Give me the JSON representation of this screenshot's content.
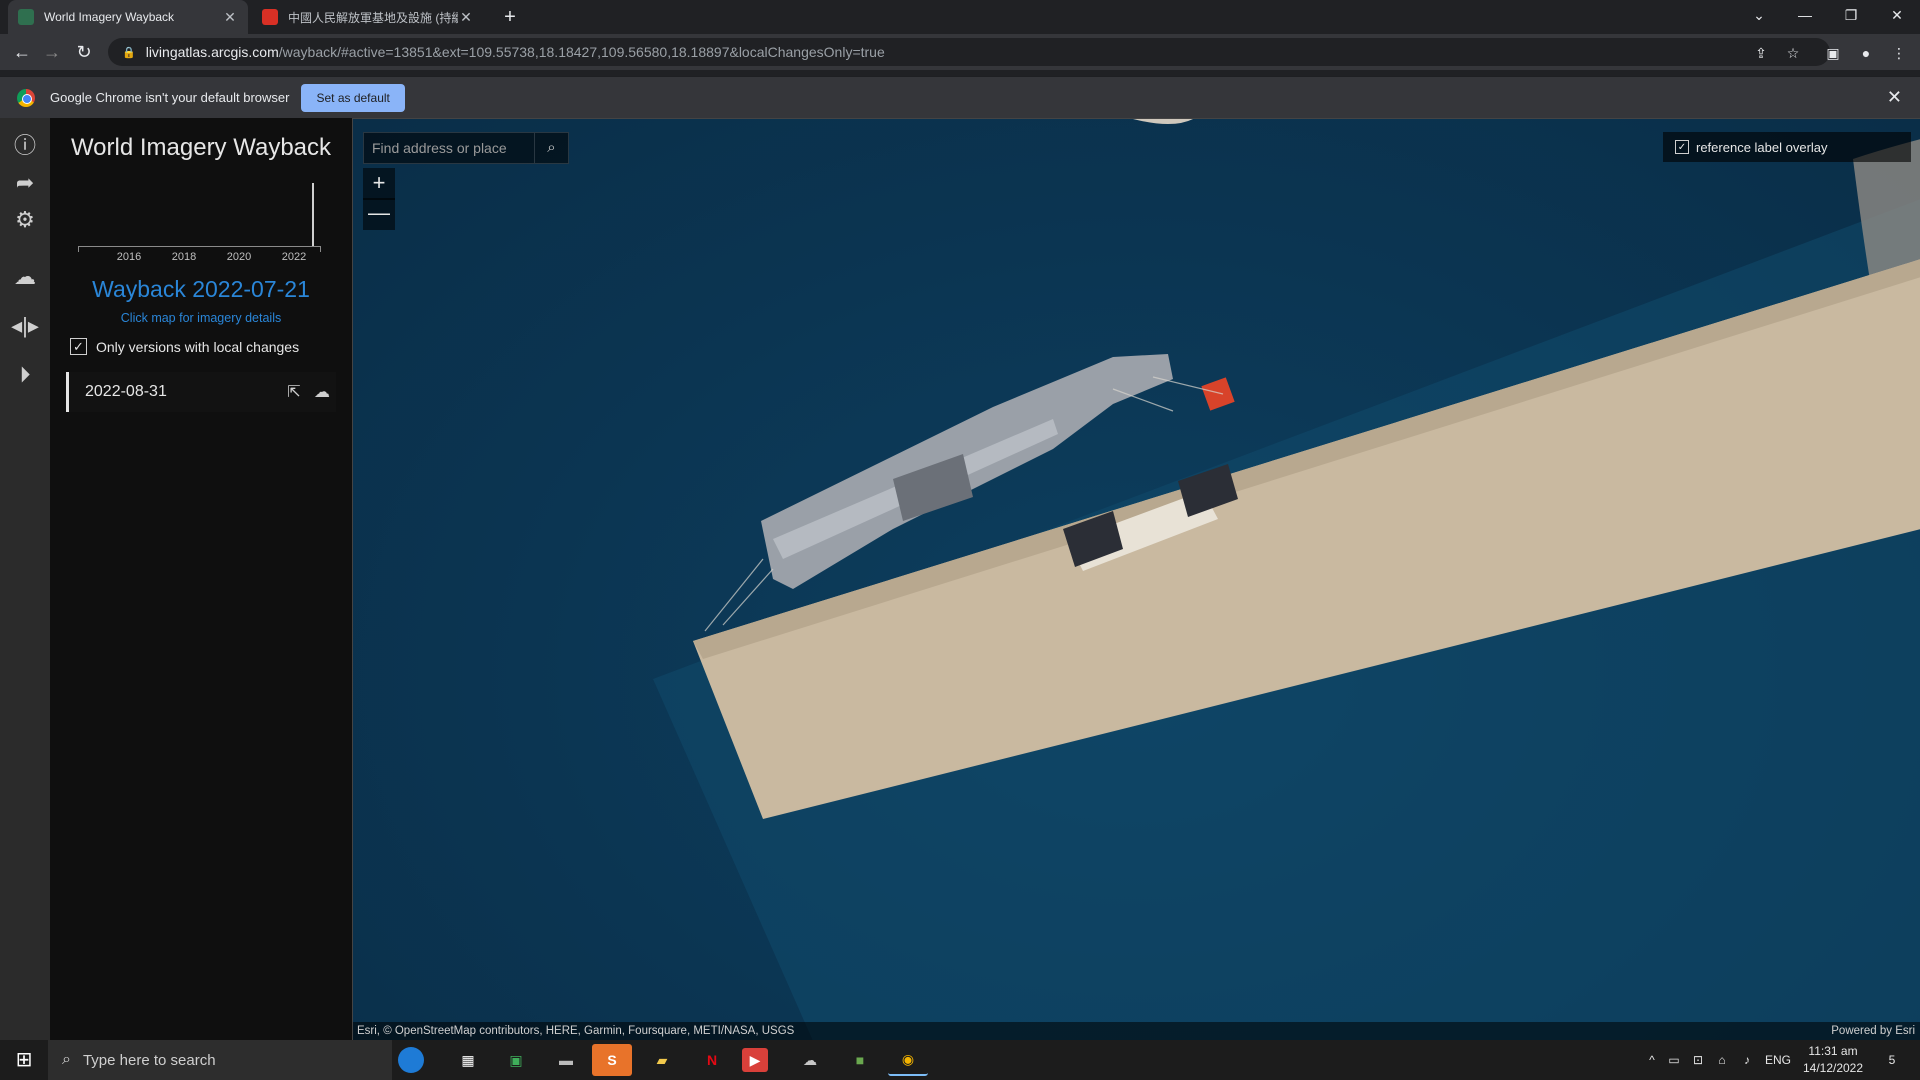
{
  "browser": {
    "tabs": [
      {
        "title": "World Imagery Wayback",
        "active": true,
        "favicon_color": "#2f6f4f"
      },
      {
        "title": "中國人民解放軍基地及設施 (持續",
        "active": false,
        "favicon_color": "#d93025"
      }
    ],
    "url_host": "livingatlas.arcgis.com",
    "url_path": "/wayback/#active=13851&ext=109.55738,18.18427,109.56580,18.18897&localChangesOnly=true",
    "infobar_message": "Google Chrome isn't your default browser",
    "infobar_button": "Set as default"
  },
  "app": {
    "title": "World Imagery Wayback",
    "timeline_years": [
      "2016",
      "2018",
      "2020",
      "2022"
    ],
    "release_label": "Wayback 2022-07-21",
    "hint": "Click map for imagery details",
    "local_changes_label": "Only versions with local changes",
    "local_changes_checked": true,
    "versions": [
      {
        "date": "2022-08-31"
      }
    ],
    "leftnav_icons": [
      "info-icon",
      "share-icon",
      "gear-icon",
      "swipe-cloud-icon",
      "swipe-icon",
      "play-icon"
    ]
  },
  "map": {
    "search_placeholder": "Find address or place",
    "zoom_in": "+",
    "zoom_out": "—",
    "overlay_label": "reference label overlay",
    "overlay_checked": true,
    "attribution": "Esri, © OpenStreetMap contributors, HERE, Garmin, Foursquare, METI/NASA, USGS",
    "powered_by": "Powered by Esri",
    "colors": {
      "water": "#0b3552",
      "pier": "#c9b9a0",
      "ship_deck": "#9aa0a8"
    }
  },
  "taskbar": {
    "search_placeholder": "Type here to search",
    "language": "ENG",
    "time": "11:31 am",
    "date": "14/12/2022",
    "notification_count": "5"
  }
}
